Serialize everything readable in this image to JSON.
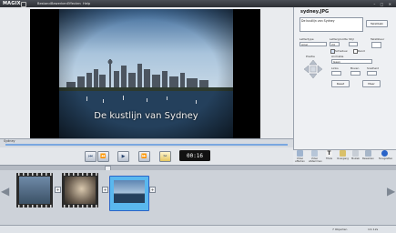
{
  "app": {
    "logo": "MAGIX"
  },
  "menu": [
    "Bestand",
    "Bewerken",
    "Effecten",
    "Help"
  ],
  "preview": {
    "caption": "De kustlijn van Sydney"
  },
  "scrub": {
    "label": "Sydney"
  },
  "transport": {
    "timecode": "00:16"
  },
  "panel": {
    "filename": "sydney.JPG",
    "text_value": "De kustlijn van Sydney",
    "text_button": "Tekstbalk",
    "lettertype_label": "Lettertype",
    "lettertype_value": "Arial",
    "lettergrootte_label": "Lettergrootte",
    "lettergrootte_value": "24",
    "stijl_label": "Stijl",
    "kleur_label": "Tekstkleur",
    "schaduw_label": "Schaduw",
    "rand_label": "Rand",
    "positie_label": "Positie",
    "animatie_label": "Animatie",
    "animatie_value": "Geen",
    "links_label": "Links",
    "boven_label": "Boven",
    "snelheid_label": "Snelheid",
    "reset_button": "Reset",
    "meer_button": "Meer"
  },
  "tools": [
    "Video effecten",
    "Video afstemmen",
    "Titels",
    "Overgang",
    "Muziek",
    "Bewerken",
    "Terugzetten"
  ],
  "storyboard": {
    "add": "+"
  },
  "status": {
    "left": "",
    "right1": "7 Objecten",
    "right2": "1m 12s"
  },
  "colors": {
    "accent": "#2a64c8",
    "menubar": "#2c2f34",
    "selected_clip": "#5ab8ee"
  }
}
